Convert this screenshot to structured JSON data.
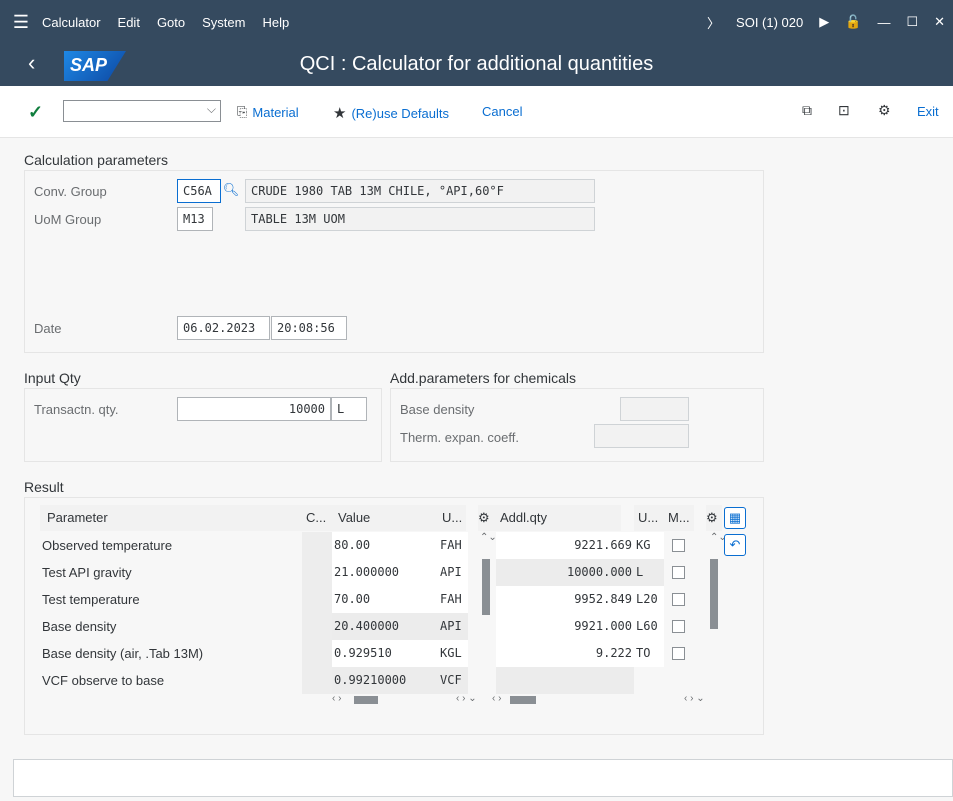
{
  "menubar": {
    "items": [
      "Calculator",
      "Edit",
      "Goto",
      "System",
      "Help"
    ],
    "system_info": "SOI (1) 020"
  },
  "titlebar": {
    "logo": "SAP",
    "title": "QCI : Calculator for additional quantities"
  },
  "toolbar": {
    "command_value": "",
    "material": "Material",
    "reuse_defaults": "(Re)use Defaults",
    "cancel": "Cancel",
    "exit": "Exit"
  },
  "calc_params": {
    "title": "Calculation parameters",
    "conv_group_label": "Conv. Group",
    "conv_group_value": "C56A",
    "conv_group_desc": "CRUDE 1980 TAB 13M CHILE, °API,60°F",
    "uom_group_label": "UoM Group",
    "uom_group_value": "M13",
    "uom_group_desc": "TABLE 13M UOM",
    "date_label": "Date",
    "date_value": "06.02.2023",
    "time_value": "20:08:56"
  },
  "input_qty": {
    "title": "Input Qty",
    "label": "Transactn. qty.",
    "value": "10000",
    "unit": "L"
  },
  "add_params": {
    "title": "Add.parameters for chemicals",
    "base_density_label": "Base density",
    "therm_label": "Therm. expan. coeff."
  },
  "result": {
    "title": "Result",
    "headers": {
      "parameter": "Parameter",
      "c": "C...",
      "value": "Value",
      "u": "U...",
      "addl_qty": "Addl.qty",
      "u2": "U...",
      "m": "M..."
    },
    "rows": [
      {
        "parameter": "Observed temperature",
        "value": "80.00",
        "unit": "FAH",
        "addl_qty": "9221.669",
        "addl_unit": "KG"
      },
      {
        "parameter": "Test API gravity",
        "value": "21.000000",
        "unit": "API",
        "addl_qty": "10000.000",
        "addl_unit": "L"
      },
      {
        "parameter": "Test temperature",
        "value": "70.00",
        "unit": "FAH",
        "addl_qty": "9952.849",
        "addl_unit": "L20"
      },
      {
        "parameter": "Base density",
        "value": "20.400000",
        "unit": "API",
        "addl_qty": "9921.000",
        "addl_unit": "L60"
      },
      {
        "parameter": "Base density (air, .Tab 13M)",
        "value": "0.929510",
        "unit": "KGL",
        "addl_qty": "9.222",
        "addl_unit": "TO"
      },
      {
        "parameter": "VCF observe to base",
        "value": "0.99210000",
        "unit": "VCF",
        "addl_qty": "",
        "addl_unit": ""
      }
    ]
  },
  "status": {
    "text": ""
  }
}
